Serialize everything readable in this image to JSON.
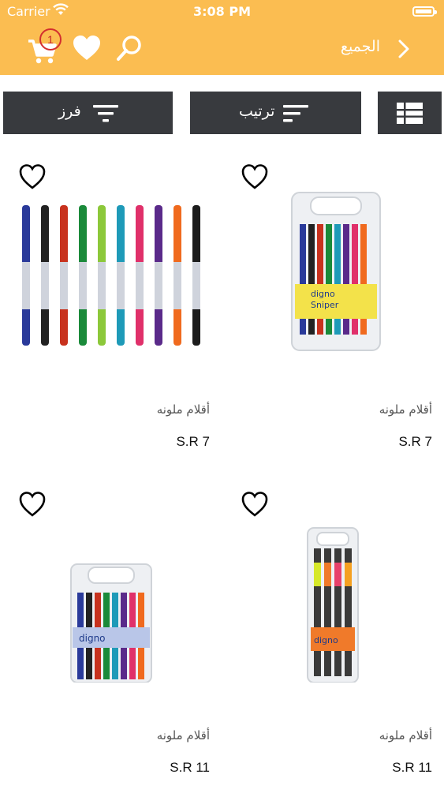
{
  "status": {
    "carrier": "Carrier",
    "time": "3:08 PM"
  },
  "navbar": {
    "back_label": "الجميع",
    "cart_count": "1"
  },
  "toolbar": {
    "filter_label": "فرز",
    "sort_label": "ترتيب"
  },
  "products": [
    {
      "name": "أقلام ملونه",
      "price": "S.R 7"
    },
    {
      "name": "أقلام ملونه",
      "price": "S.R 7"
    },
    {
      "name": "أقلام ملونه",
      "price": "S.R 11"
    },
    {
      "name": "أقلام ملونه",
      "price": "S.R 11"
    }
  ],
  "colors": {
    "header": "#fbbd51",
    "toolbar": "#383a3e",
    "badge": "#d32f2f"
  }
}
